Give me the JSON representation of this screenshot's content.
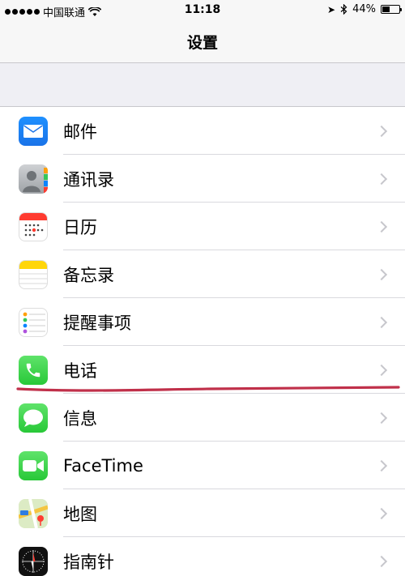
{
  "status_bar": {
    "carrier": "中国联通",
    "time": "11:18",
    "battery_percent_text": "44%",
    "battery_level": 0.44
  },
  "nav": {
    "title": "设置"
  },
  "settings_items": [
    {
      "label": "邮件",
      "icon": "mail-icon"
    },
    {
      "label": "通讯录",
      "icon": "contacts-icon"
    },
    {
      "label": "日历",
      "icon": "calendar-icon"
    },
    {
      "label": "备忘录",
      "icon": "notes-icon"
    },
    {
      "label": "提醒事项",
      "icon": "reminders-icon"
    },
    {
      "label": "电话",
      "icon": "phone-icon"
    },
    {
      "label": "信息",
      "icon": "messages-icon"
    },
    {
      "label": "FaceTime",
      "icon": "facetime-icon"
    },
    {
      "label": "地图",
      "icon": "maps-icon"
    },
    {
      "label": "指南针",
      "icon": "compass-icon"
    }
  ],
  "colors": {
    "annotation_stroke": "#c0304a",
    "chevron": "#c7c7cc"
  }
}
